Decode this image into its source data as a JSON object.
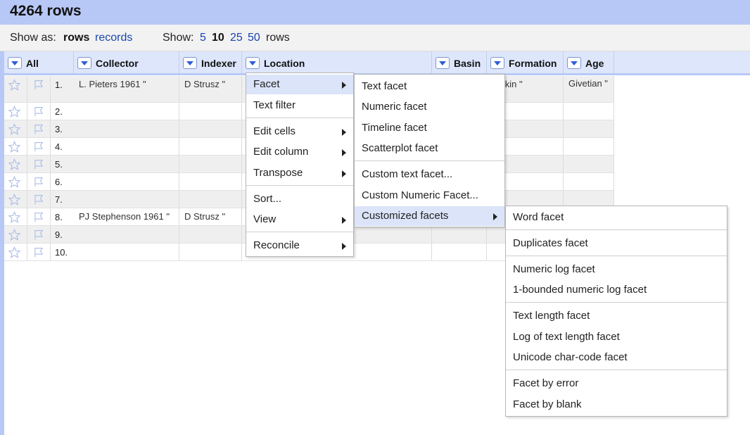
{
  "header": {
    "title": "4264 rows"
  },
  "show_bar": {
    "show_as_label": "Show as:",
    "rows_option": "rows",
    "records_option": "records",
    "show_label": "Show:",
    "counts": [
      "5",
      "10",
      "25",
      "50"
    ],
    "selected_count": "10",
    "rows_suffix": "rows"
  },
  "columns": {
    "all": "All",
    "collector": "Collector",
    "indexer": "Indexer",
    "location": "Location",
    "basin": "Basin",
    "formation": "Formation",
    "age": "Age"
  },
  "rows": [
    {
      "num": "1.",
      "collector": "L. Pieters 1961 \"",
      "indexer": "D Strusz \"",
      "formation": "rdekin \"",
      "age": "Givetian \""
    },
    {
      "num": "2."
    },
    {
      "num": "3."
    },
    {
      "num": "4."
    },
    {
      "num": "5."
    },
    {
      "num": "6."
    },
    {
      "num": "7."
    },
    {
      "num": "8.",
      "collector": "PJ Stephenson 1961 \"",
      "indexer": "D Strusz \""
    },
    {
      "num": "9."
    },
    {
      "num": "10."
    }
  ],
  "menu": {
    "facet": "Facet",
    "text_filter": "Text filter",
    "edit_cells": "Edit cells",
    "edit_column": "Edit column",
    "transpose": "Transpose",
    "sort": "Sort...",
    "view": "View",
    "reconcile": "Reconcile"
  },
  "facet_submenu": {
    "text_facet": "Text facet",
    "numeric_facet": "Numeric facet",
    "timeline_facet": "Timeline facet",
    "scatterplot_facet": "Scatterplot facet",
    "custom_text_facet": "Custom text facet...",
    "custom_numeric_facet": "Custom Numeric Facet...",
    "customized_facets": "Customized facets"
  },
  "customized_submenu": {
    "word_facet": "Word facet",
    "duplicates_facet": "Duplicates facet",
    "numeric_log_facet": "Numeric log facet",
    "bounded_log_facet": "1-bounded numeric log facet",
    "text_length_facet": "Text length facet",
    "log_text_length_facet": "Log of text length facet",
    "unicode_facet": "Unicode char-code facet",
    "facet_by_error": "Facet by error",
    "facet_by_blank": "Facet by blank"
  },
  "colors": {
    "accent": "#b8c8f6",
    "header_bg": "#dde6fb",
    "link": "#1a44b0",
    "menu_highlight": "#dbe4f8"
  },
  "icons": {
    "star": "star-icon",
    "flag": "flag-icon",
    "dropdown": "chevron-down-icon",
    "submenu": "chevron-right-icon"
  }
}
